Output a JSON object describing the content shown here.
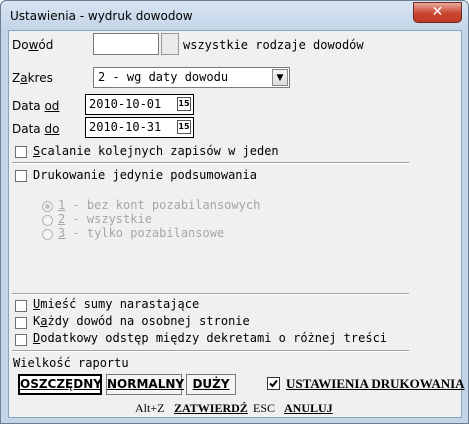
{
  "window": {
    "title": "Ustawienia - wydruk dowodow",
    "close_icon": "close-icon"
  },
  "dowod": {
    "label_pre": "Do",
    "label_u": "w",
    "label_post": "ód",
    "value": "",
    "all_types_label": "wszystkie rodzaje dowodów"
  },
  "zakres": {
    "label_pre": "Z",
    "label_u": "a",
    "label_post": "kres",
    "selected": "2 - wg daty dowodu"
  },
  "date_from": {
    "label_pre": "Data ",
    "label_u": "od",
    "value": "2010-10-01",
    "icon_text": "15"
  },
  "date_to": {
    "label_pre": "Data ",
    "label_u": "do",
    "value": "2010-10-31",
    "icon_text": "15"
  },
  "scalanie": {
    "label_u": "S",
    "label_post": "calanie kolejnych zapisów w jeden",
    "checked": false
  },
  "podsumowania": {
    "label": "Drukowanie jedynie podsumowania",
    "checked": false
  },
  "radios": [
    {
      "num": "1",
      "text": " - bez kont pozabilansowych",
      "selected": true
    },
    {
      "num": "2",
      "text": " - wszystkie",
      "selected": false
    },
    {
      "num": "3",
      "text": " - tylko pozabilansowe",
      "selected": false
    }
  ],
  "sumy": {
    "label_u": "U",
    "label_post": "mieść sumy narastające",
    "checked": false
  },
  "kazdy": {
    "label_pre": "K",
    "label_u": "a",
    "label_post": "żdy dowód na osobnej stronie",
    "checked": false
  },
  "odstep": {
    "label_u": "D",
    "label_post": "odatkowy odstęp między dekretami o różnej treści",
    "checked": false
  },
  "report_size": {
    "label": "Wielkość raportu",
    "buttons": [
      "OSZCZĘDNY",
      "NORMALNY",
      "DUŻY"
    ],
    "active": "OSZCZĘDNY"
  },
  "print_settings": {
    "label": "USTAWIENIA DRUKOWANIA",
    "checked": true
  },
  "footer": {
    "confirm_key": "Alt+Z",
    "confirm_label": "ZATWIERDŹ",
    "cancel_key": "ESC",
    "cancel_label": "ANULUJ"
  }
}
